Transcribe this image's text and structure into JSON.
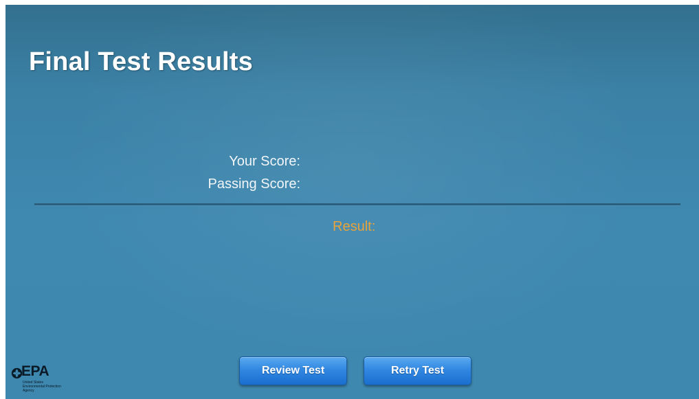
{
  "slide": {
    "title": "Final Test Results"
  },
  "scores": {
    "your_score_label": "Your Score:",
    "passing_score_label": "Passing Score:",
    "result_label": "Result:"
  },
  "buttons": {
    "review_label": "Review Test",
    "retry_label": "Retry Test"
  },
  "logo": {
    "name": "EPA",
    "subtitle_lines": [
      "United States",
      "Environmental Protection",
      "Agency"
    ]
  },
  "colors": {
    "background": "#3e87ae",
    "title": "#ffffff",
    "result_accent": "#e8a33a",
    "button": "#2f86e0"
  }
}
